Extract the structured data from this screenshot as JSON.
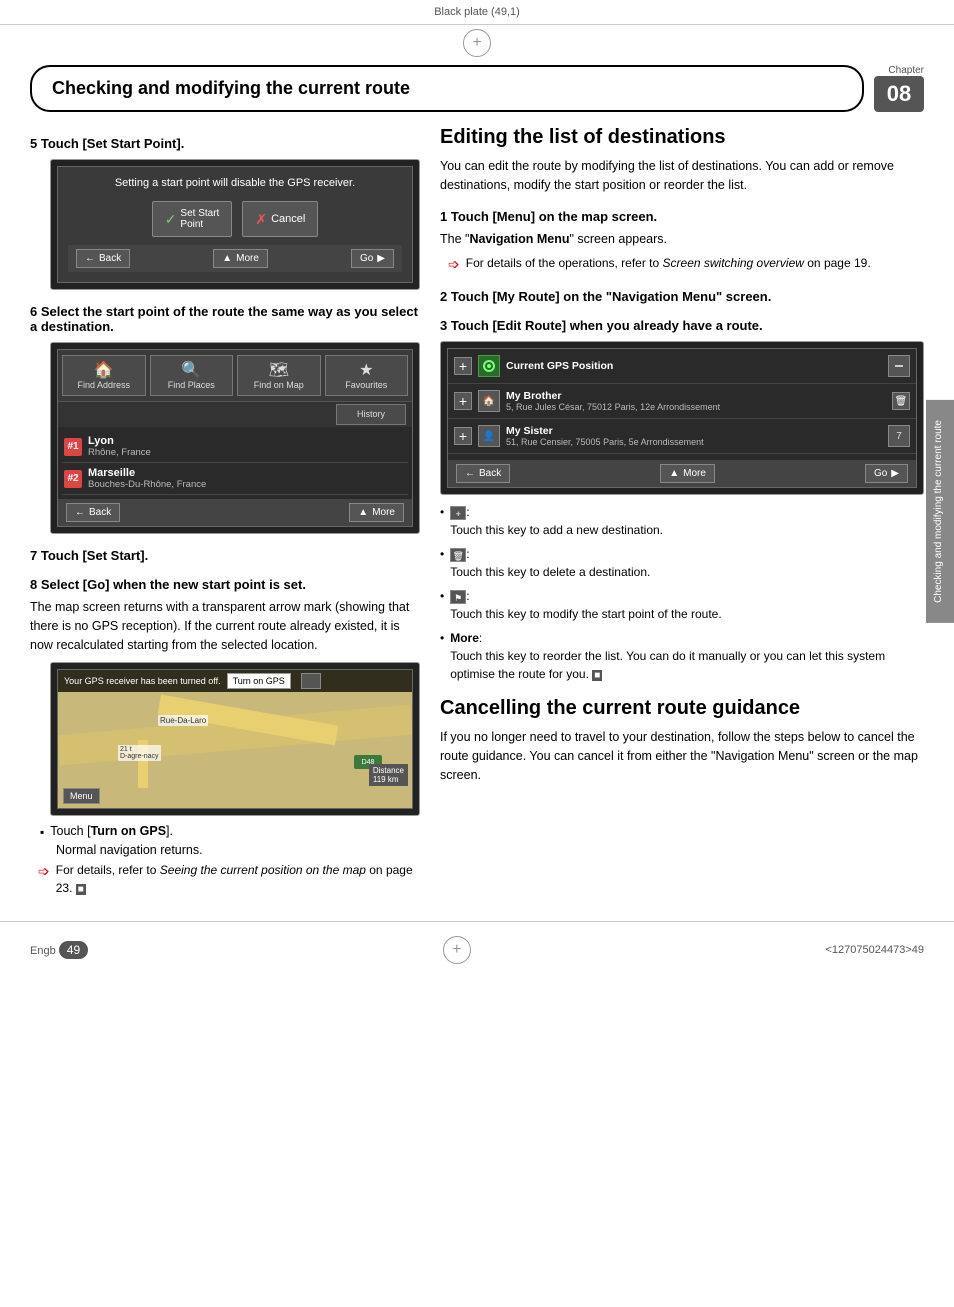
{
  "plate": {
    "text": "Black plate (49,1)"
  },
  "chapter": {
    "title": "Checking and modifying the current route",
    "label": "Chapter",
    "number": "08"
  },
  "left_col": {
    "step5": {
      "heading": "5    Touch [Set Start Point].",
      "dialog": {
        "text": "Setting a start point will disable the GPS receiver.",
        "btn_set_start": "Set Start\nPoint",
        "btn_cancel": "Cancel"
      },
      "nav_bar": {
        "back": "Back",
        "more": "More",
        "go": "Go"
      }
    },
    "step6": {
      "heading": "6    Select the start point of the route the same way as you select a destination.",
      "menu_btns": [
        "Find Address",
        "Find Places",
        "Find on Map",
        "Favourites",
        "History"
      ],
      "dest1": {
        "num": "#1",
        "name": "Lyon",
        "addr": "Rhône, France"
      },
      "dest2": {
        "num": "#2",
        "name": "Marseille",
        "addr": "Bouches-Du-Rhône, France"
      },
      "nav_bar": {
        "back": "Back",
        "more": "More"
      }
    },
    "step7": {
      "heading": "7    Touch [Set Start]."
    },
    "step8": {
      "heading": "8    Select [Go] when the new start point is set.",
      "body": "The map screen returns with a transparent arrow mark (showing that there is no GPS reception). If the current route already existed, it is now recalculated starting from the selected location.",
      "gps_warning": "Your GPS receiver has been turned off.",
      "turn_on_gps": "Turn on GPS",
      "map_label": "Rue-Da-Laro",
      "map_label2": "21 t\nD-agre-nacy",
      "distance": "Distance\n119 km",
      "menu_btn": "Menu"
    },
    "bullet_turn_on_gps": {
      "text": "Touch [Turn on GPS].",
      "subtext": "Normal navigation returns."
    },
    "arrow_note": {
      "text": "For details, refer to Seeing the current position on the map on page 23."
    }
  },
  "right_col": {
    "section1": {
      "heading": "Editing the list of destinations",
      "body": "You can edit the route by modifying the list of destinations. You can add or remove destinations, modify the start position or reorder the list."
    },
    "step1": {
      "heading": "1    Touch [Menu] on the map screen.",
      "body": "The \"Navigation Menu\" screen appears.",
      "arrow_note": "For details of the operations, refer to Screen switching overview on page 19."
    },
    "step2": {
      "heading": "2    Touch [My Route] on the \"Navigation Menu\" screen."
    },
    "step3": {
      "heading": "3    Touch [Edit Route] when you already have a route.",
      "route_items": [
        {
          "icon": "gps",
          "name": "Current GPS Position",
          "addr": ""
        },
        {
          "icon": "house",
          "name": "My Brother",
          "addr": "5, Rue Jules César, 75012 Paris, 12e Arrondissement"
        },
        {
          "icon": "person",
          "name": "My Sister",
          "addr": "51, Rue Censier, 75005 Paris, 5e Arrondissement"
        }
      ],
      "nav_bar": {
        "back": "Back",
        "more": "More",
        "go": "Go"
      }
    },
    "bullets": [
      {
        "icon": "+",
        "text": "Touch this key to add a new destination."
      },
      {
        "icon": "trash",
        "text": "Touch this key to delete a destination."
      },
      {
        "icon": "flag",
        "text": "Touch this key to modify the start point of the route."
      },
      {
        "bold_label": "More",
        "text": "Touch this key to reorder the list. You can do it manually or you can let this system optimise the route for you."
      }
    ]
  },
  "section2": {
    "heading": "Cancelling the current route guidance",
    "body": "If you no longer need to travel to your destination, follow the steps below to cancel the route guidance. You can cancel it from either the \"Navigation Menu\" screen or the map screen."
  },
  "side_tab": {
    "text": "Checking and modifying the current route"
  },
  "footer": {
    "language": "Engb",
    "page": "49",
    "barcode": "<127075024473>49"
  }
}
